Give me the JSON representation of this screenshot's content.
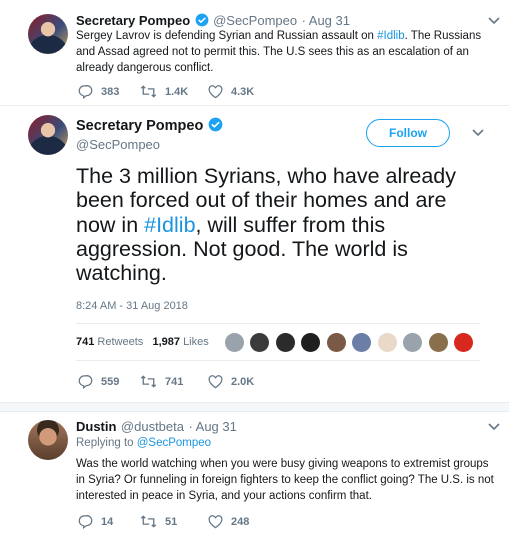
{
  "tweet1": {
    "name": "Secretary Pompeo",
    "handle": "@SecPompeo",
    "date": "· Aug 31",
    "text_before": "Sergey Lavrov is defending Syrian and Russian assault on ",
    "hashtag": "#Idlib",
    "text_after": ". The Russians and Assad agreed not to permit this. The U.S sees this as an escalation of an already dangerous conflict.",
    "replies": "383",
    "retweets": "1.4K",
    "likes": "4.3K"
  },
  "main_tweet": {
    "name": "Secretary Pompeo",
    "handle": "@SecPompeo",
    "follow_label": "Follow",
    "text_before": "The 3 million Syrians, who have already been forced out of their homes and are now in ",
    "hashtag": "#Idlib",
    "text_after": ", will suffer from this aggression. Not good. The world is watching.",
    "timestamp": "8:24 AM - 31 Aug 2018",
    "retweets_count": "741",
    "retweets_label": "Retweets",
    "likes_count": "1,987",
    "likes_label": "Likes",
    "replies": "559",
    "retweets": "741",
    "likes": "2.0K"
  },
  "reply": {
    "name": "Dustin",
    "handle": "@dustbeta",
    "date": "· Aug 31",
    "replying_label": "Replying to ",
    "replying_to": "@SecPompeo",
    "text": "Was the world watching when you were busy giving weapons to extremist groups in Syria? Or funneling in foreign fighters to keep the conflict going? The U.S. is not interested in peace in Syria, and your actions confirm that.",
    "replies": "14",
    "retweets": "51",
    "likes": "248"
  },
  "colors": {
    "link_blue": "#1b95e0",
    "muted_gray": "#657786",
    "divider": "#e6ecf0"
  }
}
